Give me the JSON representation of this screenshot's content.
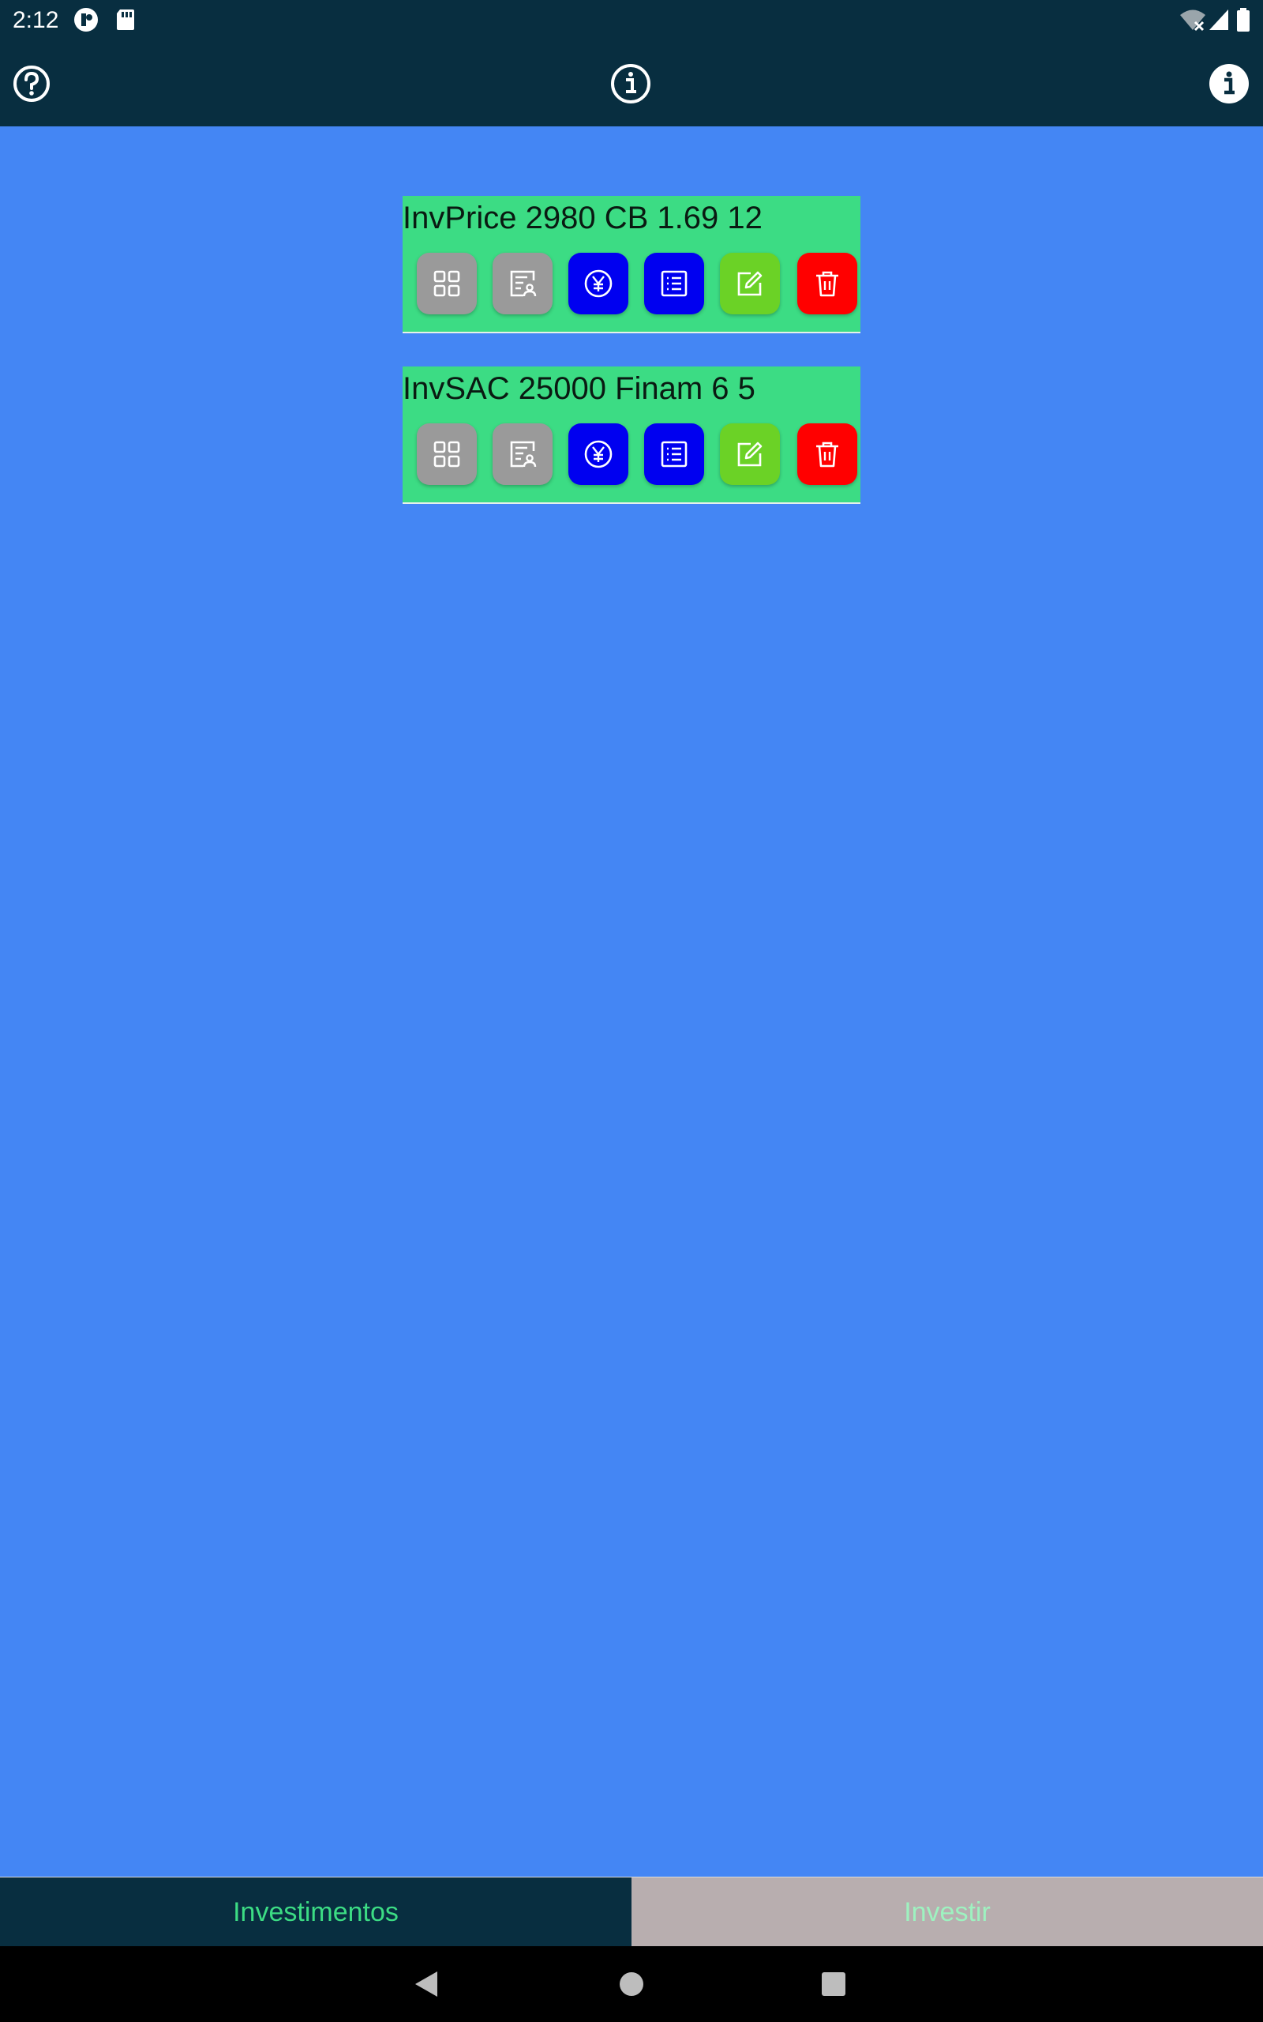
{
  "status_bar": {
    "time": "2:12",
    "left_icons": [
      "app-notification-icon",
      "sd-card-icon"
    ],
    "right_icons": [
      "wifi-off-icon",
      "cell-signal-icon",
      "battery-icon"
    ]
  },
  "app_bar": {
    "buttons": [
      "help-circle-icon",
      "info-outline-icon",
      "info-filled-icon"
    ]
  },
  "investments": [
    {
      "title": "InvPrice 2980 CB 1.69 12",
      "actions": [
        "grid-icon",
        "profile-card-icon",
        "yen-icon",
        "list-icon",
        "edit-icon",
        "trash-icon"
      ]
    },
    {
      "title": "InvSAC 25000 Finam 6 5",
      "actions": [
        "grid-icon",
        "profile-card-icon",
        "yen-icon",
        "list-icon",
        "edit-icon",
        "trash-icon"
      ]
    }
  ],
  "bottom_tabs": {
    "tab1": "Investimentos",
    "tab2": "Investir"
  },
  "colors": {
    "app_bar": "#082E40",
    "background": "#4486F4",
    "card": "#3CDC84",
    "grey_button": "#9A9A9A",
    "blue_button": "#0000F0",
    "green_button": "#6BD226",
    "red_button": "#FF0000"
  }
}
